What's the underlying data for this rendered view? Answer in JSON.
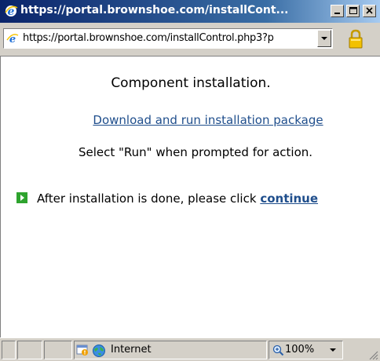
{
  "window": {
    "title": "https://portal.brownshoe.com/installCont...",
    "title_icon": "ie-icon",
    "controls": [
      "minimize",
      "maximize",
      "close"
    ]
  },
  "address_bar": {
    "url": "https://portal.brownshoe.com/installControl.php3?p",
    "lock_icon": "padlock-icon"
  },
  "page": {
    "heading": "Component installation.",
    "download_link": "Download and run installation package",
    "instruction": "Select \"Run\" when prompted for action.",
    "after_text": "After installation is done, please click ",
    "continue_link": "continue"
  },
  "status_bar": {
    "zone": "Internet",
    "zoom": "100%"
  },
  "colors": {
    "title_gradient_start": "#0a246a",
    "title_gradient_end": "#a6caf0",
    "link": "#1f4e8c",
    "chrome": "#d4d0c8",
    "arrow_green": "#2ea32e"
  }
}
